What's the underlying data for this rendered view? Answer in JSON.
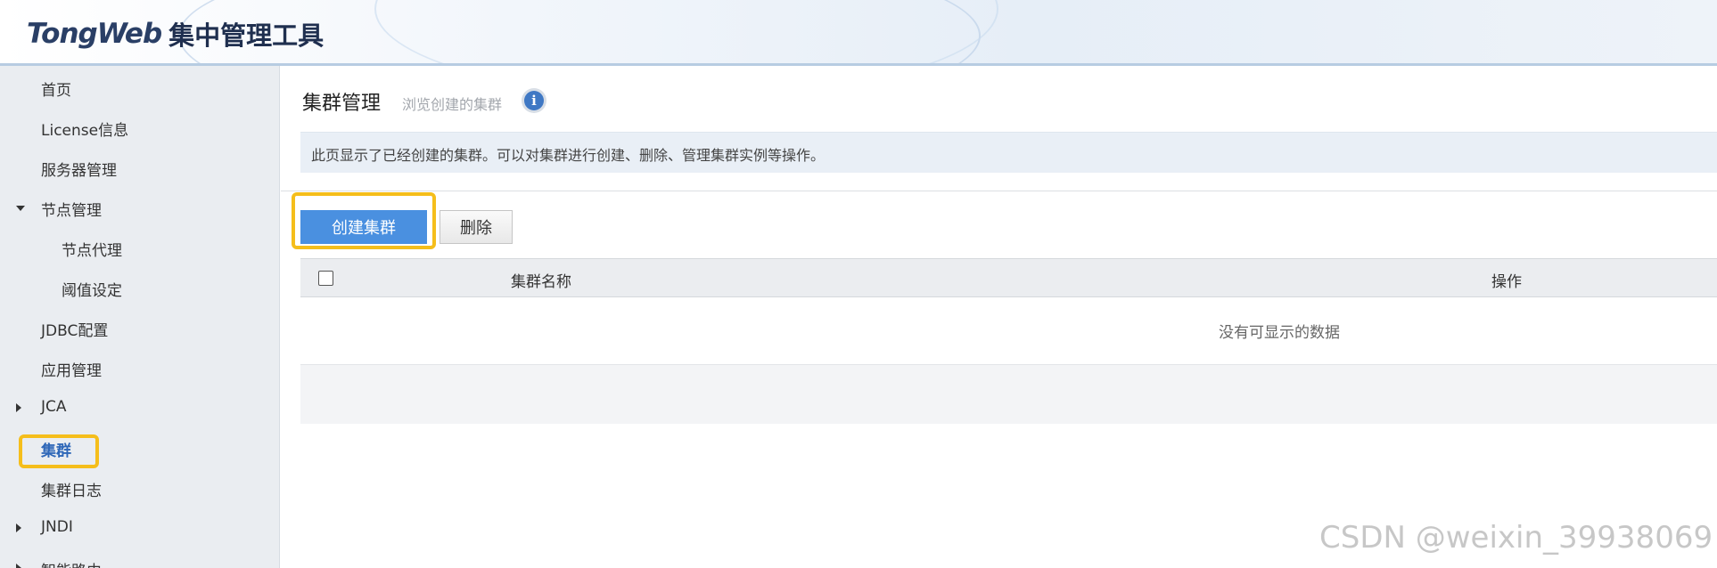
{
  "header": {
    "logo_text": "TongWeb",
    "subtitle": "集中管理工具"
  },
  "sidebar": {
    "items": [
      {
        "label": "首页"
      },
      {
        "label": "License信息"
      },
      {
        "label": "服务器管理"
      },
      {
        "label": "节点管理"
      },
      {
        "label": "节点代理"
      },
      {
        "label": "阈值设定"
      },
      {
        "label": "JDBC配置"
      },
      {
        "label": "应用管理"
      },
      {
        "label": "JCA"
      },
      {
        "label": "集群"
      },
      {
        "label": "集群日志"
      },
      {
        "label": "JNDI"
      },
      {
        "label": "智能路由"
      }
    ]
  },
  "main": {
    "title": "集群管理",
    "subtitle": "浏览创建的集群",
    "info_icon_glyph": "i",
    "description": "此页显示了已经创建的集群。可以对集群进行创建、删除、管理集群实例等操作。",
    "buttons": {
      "create_label": "创建集群",
      "delete_label": "删除"
    },
    "table": {
      "columns": [
        "集群名称",
        "操作"
      ],
      "empty_message": "没有可显示的数据"
    }
  },
  "watermark": "CSDN @weixin_39938069",
  "colors": {
    "accent": "#4a90e0",
    "highlight": "#f5be1b",
    "sidebar_bg": "#eaedf1"
  }
}
